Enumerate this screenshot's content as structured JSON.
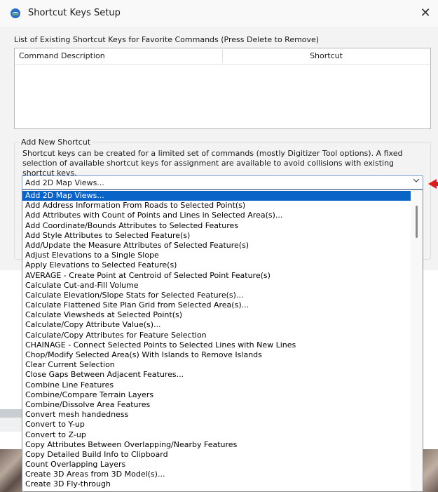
{
  "window": {
    "title": "Shortcut Keys Setup",
    "close_glyph": "✕"
  },
  "existing": {
    "caption": "List of Existing Shortcut Keys for Favorite Commands (Press Delete to Remove)",
    "columns": [
      "Command Description",
      "Shortcut"
    ]
  },
  "add_new": {
    "group_label": "Add New Shortcut",
    "description": "Shortcut keys can be created for a limited set of commands (mostly Digitizer Tool options). A fixed selection of available shortcut keys for assignment are available to avoid collisions with existing shortcut keys.",
    "combo_value": "Add 2D Map Views...",
    "combo_arrow": "⌵",
    "options": [
      "Add 2D Map Views...",
      "Add Address Information From Roads to Selected Point(s)",
      "Add Attributes with Count of Points and Lines in Selected Area(s)...",
      "Add Coordinate/Bounds Attributes to Selected Features",
      "Add Style Attributes to Selected Feature(s)",
      "Add/Update the Measure Attributes of Selected Feature(s)",
      "Adjust Elevations to a Single Slope",
      "Apply Elevations to Selected Feature(s)",
      "AVERAGE - Create Point at Centroid of Selected Point Feature(s)",
      "Calculate Cut-and-Fill Volume",
      "Calculate Elevation/Slope Stats for Selected Feature(s)...",
      "Calculate Flattened Site Plan Grid from Selected Area(s)...",
      "Calculate Viewsheds at Selected Point(s)",
      "Calculate/Copy Attribute Value(s)...",
      "Calculate/Copy Attributes for Feature Selection",
      "CHAINAGE - Connect Selected Points to Selected Lines with New Lines",
      "Chop/Modify Selected Area(s) With Islands to Remove Islands",
      "Clear Current Selection",
      "Close Gaps Between Adjacent Features...",
      "Combine Line Features",
      "Combine/Compare Terrain Layers",
      "Combine/Dissolve Area Features",
      "Convert mesh handedness",
      "Convert to Y-up",
      "Convert to Z-up",
      "Copy Attributes Between Overlapping/Nearby Features",
      "Copy Detailed Build Info to Clipboard",
      "Count Overlapping Layers",
      "Create 3D Areas from 3D Model(s)...",
      "Create 3D Fly-through"
    ],
    "selected_index": 0
  },
  "colors": {
    "selection": "#0a64c8",
    "annotation_arrow": "#d42020"
  }
}
